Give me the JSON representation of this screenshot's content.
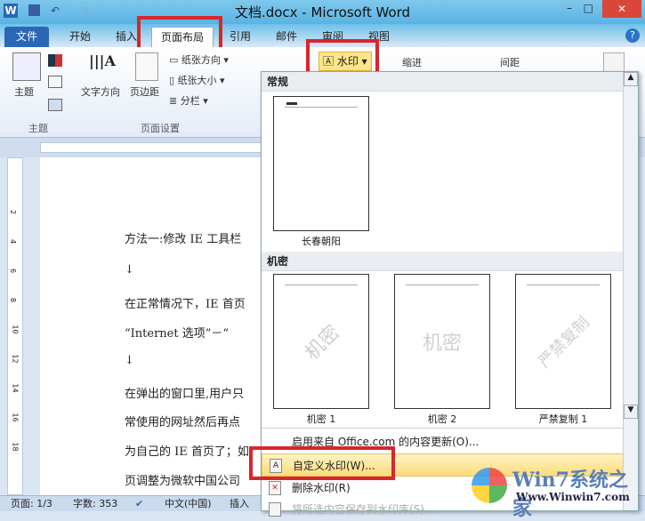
{
  "window": {
    "title": "文档.docx - Microsoft Word",
    "minimize": "–",
    "maximize": "□",
    "close": "✕"
  },
  "quick_access": {
    "app_icon": "W",
    "undo": "↶",
    "redo": "↷"
  },
  "tabs": [
    "文件",
    "开始",
    "插入",
    "页面布局",
    "引用",
    "邮件",
    "审阅",
    "视图"
  ],
  "ribbon": {
    "theme": "主题",
    "text_direction": "文字方向",
    "margins": "页边距",
    "orientation": "纸张方向",
    "size": "纸张大小",
    "columns": "分栏",
    "group_theme": "主题",
    "group_page_setup": "页面设置",
    "watermark": "水印",
    "indent": "缩进",
    "spacing": "间距"
  },
  "document": {
    "lines": [
      "方法一:修改 IE 工具栏",
      "↓",
      "在正常情况下，IE 首页",
      "“Internet 选项”－“",
      "↓",
      "在弹出的窗口里,用户只",
      "常使用的网址然后再点",
      "为自己的 IE 首页了；如",
      "页调整为微软中国公司"
    ]
  },
  "ruler": {
    "v_marks": [
      "2",
      "4",
      "6",
      "8",
      "10",
      "12",
      "14",
      "16",
      "18"
    ]
  },
  "watermark_menu": {
    "section_general": "常规",
    "general_items": [
      {
        "caption": "长春朝阳"
      }
    ],
    "section_confidential": "机密",
    "confidential_items": [
      {
        "caption": "机密 1",
        "text": "机密"
      },
      {
        "caption": "机密 2",
        "text": "机密"
      },
      {
        "caption": "严禁复制 1",
        "text": "严禁复制"
      }
    ],
    "items": [
      "启用来自 Office.com 的内容更新(O)...",
      "自定义水印(W)...",
      "删除水印(R)",
      "将所选内容保存到水印库(S)..."
    ]
  },
  "status": {
    "page": "页面: 1/3",
    "words": "字数: 353",
    "language": "中文(中国)",
    "mode": "插入"
  },
  "brand": {
    "name": "Win7系统之家",
    "url": "Www.Winwin7.com"
  },
  "colors": {
    "accent": "#2a67b5",
    "highlight": "#d8262b",
    "hover": "#fde58a"
  }
}
